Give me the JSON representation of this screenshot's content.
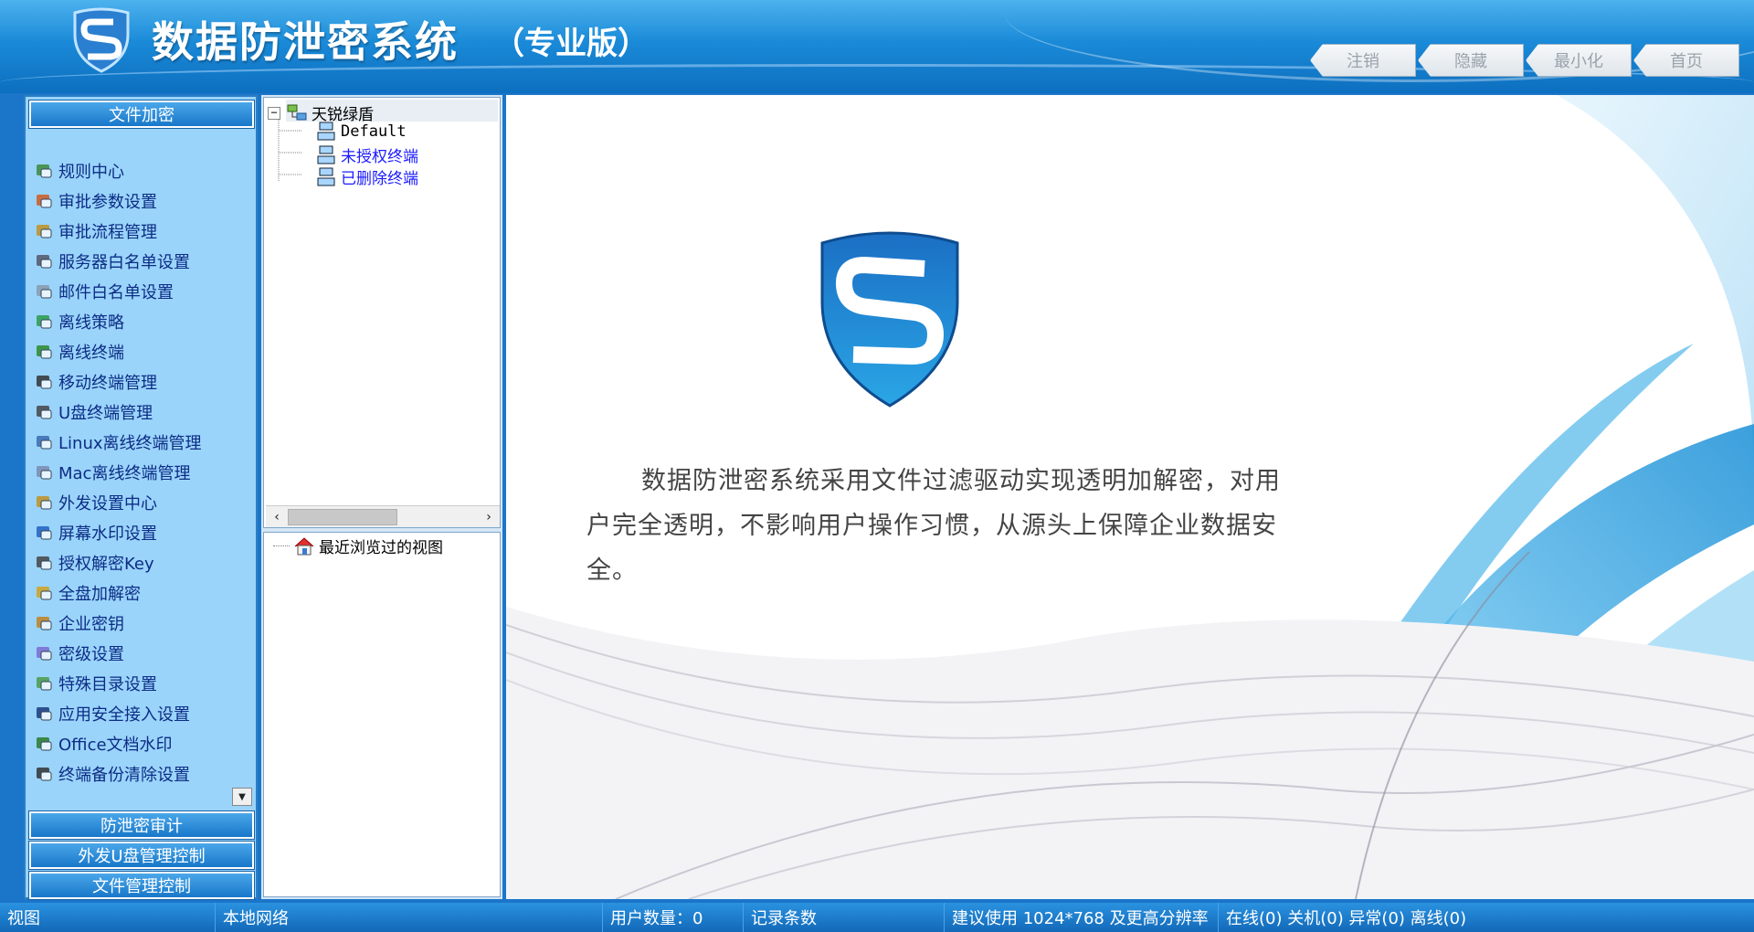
{
  "header": {
    "title": "数据防泄密系统",
    "edition": "（专业版）",
    "nav": [
      "注销",
      "隐藏",
      "最小化",
      "首页"
    ]
  },
  "left_panel": {
    "section_top": "文件加密",
    "menu_items": [
      {
        "label": "规则中心",
        "icon": "rules-icon"
      },
      {
        "label": "审批参数设置",
        "icon": "approval-params-icon"
      },
      {
        "label": "审批流程管理",
        "icon": "workflow-icon"
      },
      {
        "label": "服务器白名单设置",
        "icon": "server-icon"
      },
      {
        "label": "邮件白名单设置",
        "icon": "mail-icon"
      },
      {
        "label": "离线策略",
        "icon": "offline-policy-icon"
      },
      {
        "label": "离线终端",
        "icon": "offline-terminal-icon"
      },
      {
        "label": "移动终端管理",
        "icon": "mobile-icon"
      },
      {
        "label": "U盘终端管理",
        "icon": "usb-icon"
      },
      {
        "label": "Linux离线终端管理",
        "icon": "linux-icon"
      },
      {
        "label": "Mac离线终端管理",
        "icon": "mac-icon"
      },
      {
        "label": "外发设置中心",
        "icon": "outgoing-icon"
      },
      {
        "label": "屏幕水印设置",
        "icon": "screen-watermark-icon"
      },
      {
        "label": "授权解密Key",
        "icon": "key-lock-icon"
      },
      {
        "label": "全盘加解密",
        "icon": "disk-encrypt-icon"
      },
      {
        "label": "企业密钥",
        "icon": "enterprise-key-icon"
      },
      {
        "label": "密级设置",
        "icon": "security-level-icon"
      },
      {
        "label": "特殊目录设置",
        "icon": "special-dir-icon"
      },
      {
        "label": "应用安全接入设置",
        "icon": "app-access-icon"
      },
      {
        "label": "Office文档水印",
        "icon": "office-watermark-icon"
      },
      {
        "label": "终端备份清除设置",
        "icon": "backup-clear-icon"
      }
    ],
    "sections_bottom": [
      "防泄密审计",
      "外发U盘管理控制",
      "文件管理控制"
    ]
  },
  "tree": {
    "root": "天锐绿盾",
    "children": [
      "Default",
      "未授权终端",
      "已删除终端"
    ],
    "recent": "最近浏览过的视图"
  },
  "main": {
    "intro": "数据防泄密系统采用文件过滤驱动实现透明加解密，对用户完全透明，不影响用户操作习惯，从源头上保障企业数据安全。"
  },
  "statusbar": {
    "view": "视图",
    "network": "本地网络",
    "user_count": "用户数量：0",
    "records": "记录条数",
    "resolution": "建议使用 1024*768 及更高分辨率",
    "status": "在线(0) 关机(0) 异常(0) 离线(0)"
  },
  "colors": {
    "header_blue": "#1a8ad8",
    "panel_blue": "#9ad4fb",
    "link_blue": "#1a1aff",
    "menu_text": "#0d2c84"
  }
}
